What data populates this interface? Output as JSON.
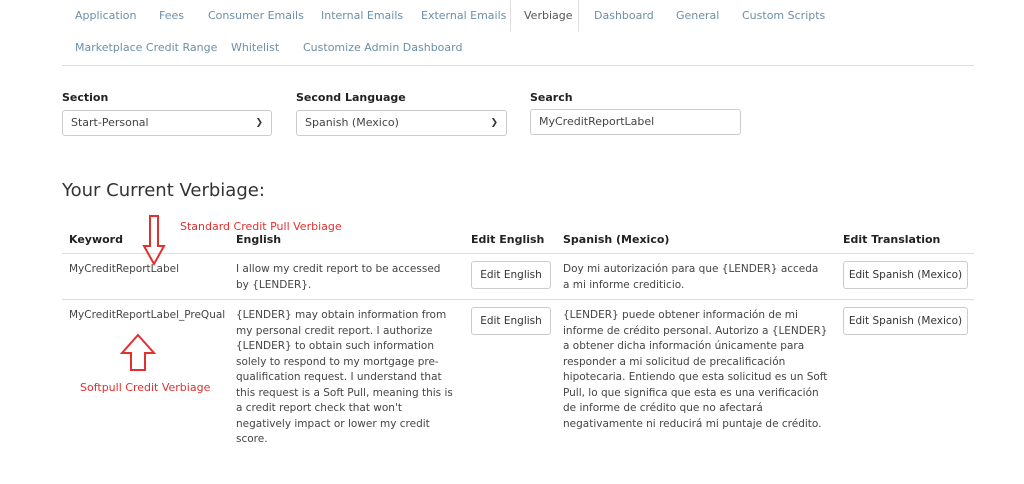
{
  "tabs": [
    {
      "label": "Application"
    },
    {
      "label": "Fees"
    },
    {
      "label": "Consumer Emails"
    },
    {
      "label": "Internal Emails"
    },
    {
      "label": "External Emails"
    },
    {
      "label": "Verbiage",
      "active": true
    },
    {
      "label": "Dashboard"
    },
    {
      "label": "General"
    },
    {
      "label": "Custom Scripts"
    },
    {
      "label": "Marketplace Credit Range"
    },
    {
      "label": "Whitelist"
    },
    {
      "label": "Customize Admin Dashboard"
    }
  ],
  "filters": {
    "section_label": "Section",
    "section_value": "Start-Personal",
    "language_label": "Second Language",
    "language_value": "Spanish (Mexico)",
    "search_label": "Search",
    "search_value": "MyCreditReportLabel"
  },
  "heading": "Your Current Verbiage:",
  "table": {
    "headers": {
      "keyword": "Keyword",
      "english": "English",
      "edit_english": "Edit English",
      "spanish": "Spanish (Mexico)",
      "edit_translation": "Edit Translation"
    },
    "rows": [
      {
        "keyword": "MyCreditReportLabel",
        "english": "I allow my credit report to be accessed by {LENDER}.",
        "edit_english_button": "Edit English",
        "spanish": "Doy mi autorización para que {LENDER} acceda a mi informe crediticio.",
        "edit_translation_button": "Edit Spanish (Mexico)"
      },
      {
        "keyword": "MyCreditReportLabel_PreQual",
        "english": "{LENDER} may obtain information from my personal credit report. I authorize {LENDER} to obtain such information solely to respond to my mortgage pre-qualification request. I understand that this request is a Soft Pull, meaning this is a credit report check that won't negatively impact or lower my credit score.",
        "edit_english_button": "Edit English",
        "spanish": "{LENDER} puede obtener información de mi informe de crédito personal. Autorizo a {LENDER} a obtener dicha información únicamente para responder a mi solicitud de precalificación hipotecaria. Entiendo que esta solicitud es un Soft Pull, lo que significa que esta es una verificación de informe de crédito que no afectará negativamente ni reducirá mi puntaje de crédito.",
        "edit_translation_button": "Edit Spanish (Mexico)"
      }
    ]
  },
  "annotations": {
    "top": "Standard Credit Pull Verbiage",
    "bottom": "Softpull Credit Verbiage",
    "color": "#e03030"
  }
}
